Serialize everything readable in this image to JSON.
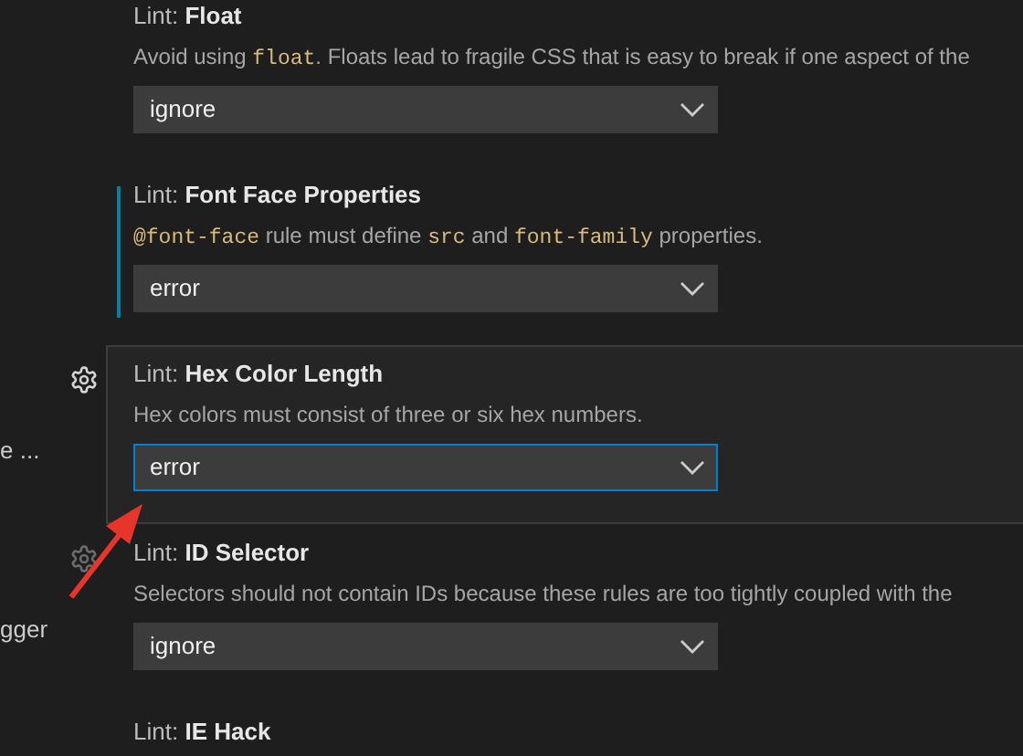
{
  "settings": [
    {
      "prefix": "Lint:",
      "title": "Float",
      "description": [
        {
          "kind": "text",
          "text": "Avoid using "
        },
        {
          "kind": "code",
          "text": "float"
        },
        {
          "kind": "text",
          "text": ". Floats lead to fragile CSS that is easy to break if one aspect of the"
        }
      ],
      "value": "ignore",
      "modified": false,
      "focused": false,
      "gear": false
    },
    {
      "prefix": "Lint:",
      "title": "Font Face Properties",
      "description": [
        {
          "kind": "code",
          "text": "@font-face"
        },
        {
          "kind": "text",
          "text": " rule must define "
        },
        {
          "kind": "code",
          "text": "src"
        },
        {
          "kind": "text",
          "text": " and "
        },
        {
          "kind": "code",
          "text": "font-family"
        },
        {
          "kind": "text",
          "text": " properties."
        }
      ],
      "value": "error",
      "modified": true,
      "focused": false,
      "gear": false
    },
    {
      "prefix": "Lint:",
      "title": "Hex Color Length",
      "description": [
        {
          "kind": "text",
          "text": "Hex colors must consist of three or six hex numbers."
        }
      ],
      "value": "error",
      "modified": false,
      "focused": true,
      "gear": true,
      "side_label": "e ..."
    },
    {
      "prefix": "Lint:",
      "title": "ID Selector",
      "description": [
        {
          "kind": "text",
          "text": "Selectors should not contain IDs because these rules are too tightly coupled with the"
        }
      ],
      "value": "ignore",
      "modified": false,
      "focused": false,
      "gear": true,
      "side_label": "gger"
    },
    {
      "prefix": "Lint:",
      "title": "IE Hack",
      "modified": false,
      "focused": false,
      "gear": false
    }
  ]
}
